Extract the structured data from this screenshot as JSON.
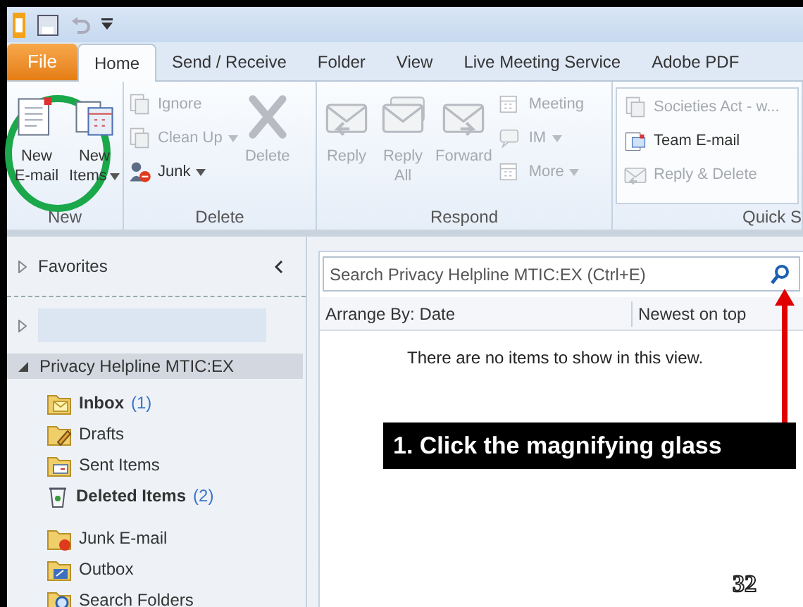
{
  "tabs": [
    {
      "label": "File",
      "kind": "file",
      "selected": false
    },
    {
      "label": "Home",
      "kind": "tab",
      "selected": true
    },
    {
      "label": "Send / Receive",
      "kind": "tab",
      "selected": false
    },
    {
      "label": "Folder",
      "kind": "tab",
      "selected": false
    },
    {
      "label": "View",
      "kind": "tab",
      "selected": false
    },
    {
      "label": "Live Meeting Service",
      "kind": "tab",
      "selected": false
    },
    {
      "label": "Adobe PDF",
      "kind": "tab",
      "selected": false
    }
  ],
  "ribbon": {
    "groups": [
      {
        "label": "New",
        "columns": [
          {
            "kind": "large",
            "items": [
              {
                "kind": "mail",
                "lines": [
                  "New",
                  "E-mail"
                ],
                "disabled": false,
                "dropdown": false
              }
            ]
          },
          {
            "kind": "large",
            "items": [
              {
                "kind": "items",
                "lines": [
                  "New",
                  "Items"
                ],
                "disabled": false,
                "dropdown": true
              }
            ]
          }
        ]
      },
      {
        "label": "Delete",
        "columns": [
          {
            "kind": "small",
            "items": [
              {
                "kind": "ignore",
                "lines": [
                  "Ignore"
                ],
                "disabled": true,
                "dropdown": false
              },
              {
                "kind": "cleanup",
                "lines": [
                  "Clean Up"
                ],
                "disabled": true,
                "dropdown": true
              },
              {
                "kind": "junk",
                "lines": [
                  "Junk"
                ],
                "disabled": false,
                "dropdown": true
              }
            ]
          },
          {
            "kind": "large",
            "items": [
              {
                "kind": "delete",
                "lines": [
                  "Delete"
                ],
                "disabled": true,
                "dropdown": false
              }
            ]
          }
        ]
      },
      {
        "label": "Respond",
        "columns": [
          {
            "kind": "large",
            "items": [
              {
                "kind": "reply",
                "lines": [
                  "Reply"
                ],
                "disabled": true,
                "dropdown": false
              }
            ]
          },
          {
            "kind": "large",
            "items": [
              {
                "kind": "replyall",
                "lines": [
                  "Reply",
                  "All"
                ],
                "disabled": true,
                "dropdown": false
              }
            ]
          },
          {
            "kind": "large",
            "items": [
              {
                "kind": "forward",
                "lines": [
                  "Forward"
                ],
                "disabled": true,
                "dropdown": false
              }
            ]
          },
          {
            "kind": "small",
            "items": [
              {
                "kind": "meeting",
                "lines": [
                  "Meeting"
                ],
                "disabled": true,
                "dropdown": false
              },
              {
                "kind": "im",
                "lines": [
                  "IM"
                ],
                "disabled": true,
                "dropdown": true
              },
              {
                "kind": "more",
                "lines": [
                  "More"
                ],
                "disabled": true,
                "dropdown": true
              }
            ]
          }
        ]
      },
      {
        "label": "Quick S",
        "columns": [
          {
            "kind": "quick",
            "items": [
              {
                "kind": "doc",
                "lines": [
                  "Societies Act - w..."
                ],
                "disabled": true,
                "dropdown": false
              },
              {
                "kind": "team",
                "lines": [
                  "Team E-mail"
                ],
                "disabled": false,
                "dropdown": false
              },
              {
                "kind": "reply",
                "lines": [
                  "Reply & Delete"
                ],
                "disabled": true,
                "dropdown": false
              }
            ]
          }
        ]
      }
    ]
  },
  "navigation": {
    "favorites": {
      "label": "Favorites",
      "expanded": false
    },
    "blank_row": {
      "expanded": false
    },
    "mailbox": {
      "label": "Privacy Helpline MTIC:EX",
      "expanded": true,
      "folders": [
        {
          "kind": "inbox",
          "name": "Inbox",
          "count": "(1)",
          "unread": true
        },
        {
          "kind": "drafts",
          "name": "Drafts",
          "unread": false
        },
        {
          "kind": "sent",
          "name": "Sent Items",
          "unread": false
        },
        {
          "kind": "deleted",
          "name": "Deleted Items",
          "count": "(2)",
          "unread": true
        },
        {
          "kind": "junk",
          "name": "Junk E-mail",
          "unread": false
        },
        {
          "kind": "outbox",
          "name": "Outbox",
          "unread": false
        },
        {
          "kind": "search",
          "name": "Search Folders",
          "unread": false
        }
      ]
    }
  },
  "message_list": {
    "search": {
      "placeholder": "Search Privacy Helpline MTIC:EX (Ctrl+E)"
    },
    "arrange_by": "Arrange By: Date",
    "sort_order": "Newest on top",
    "empty_message": "There are no items to show in this view."
  },
  "callout": "1. Click the magnifying glass",
  "slide_number": "32"
}
